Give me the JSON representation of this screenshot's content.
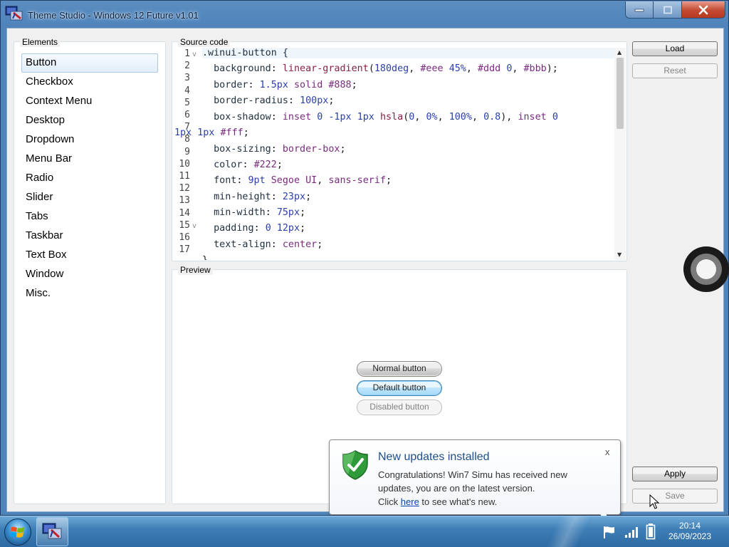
{
  "window": {
    "title": "Theme Studio - Windows 12 Future v1.01",
    "caption": {
      "minimize": "minimize",
      "maximize": "maximize",
      "close": "close"
    }
  },
  "elements": {
    "label": "Elements",
    "items": [
      {
        "label": "Button",
        "selected": true
      },
      {
        "label": "Checkbox"
      },
      {
        "label": "Context Menu"
      },
      {
        "label": "Desktop"
      },
      {
        "label": "Dropdown"
      },
      {
        "label": "Menu Bar"
      },
      {
        "label": "Radio"
      },
      {
        "label": "Slider"
      },
      {
        "label": "Tabs"
      },
      {
        "label": "Taskbar"
      },
      {
        "label": "Text Box"
      },
      {
        "label": "Window"
      },
      {
        "label": "Misc."
      }
    ]
  },
  "source": {
    "label": "Source code",
    "line_numbers": [
      "1",
      "2",
      "3",
      "4",
      "5",
      "6",
      "7",
      "8",
      "9",
      "10",
      "11",
      "12",
      "13",
      "14",
      "15",
      "16",
      "17"
    ],
    "fold_rows": [
      0,
      14
    ]
  },
  "preview": {
    "label": "Preview",
    "normal_button": "Normal button",
    "default_button": "Default button",
    "disabled_button": "Disabled button"
  },
  "actions": {
    "load": "Load",
    "reset": "Reset",
    "apply": "Apply",
    "save": "Save"
  },
  "notification": {
    "title": "New updates installed",
    "close": "x",
    "line1": "Congratulations! Win7 Simu has received new",
    "line2": "updates, you are on the latest version.",
    "line3_before": "Click ",
    "line3_link": "here",
    "line3_after": " to see what's new."
  },
  "taskbar": {
    "time": "20:14",
    "date": "26/09/2023"
  },
  "colors": {
    "accent": "#4f84bb",
    "close": "#c24a31",
    "link": "#0645ad"
  }
}
